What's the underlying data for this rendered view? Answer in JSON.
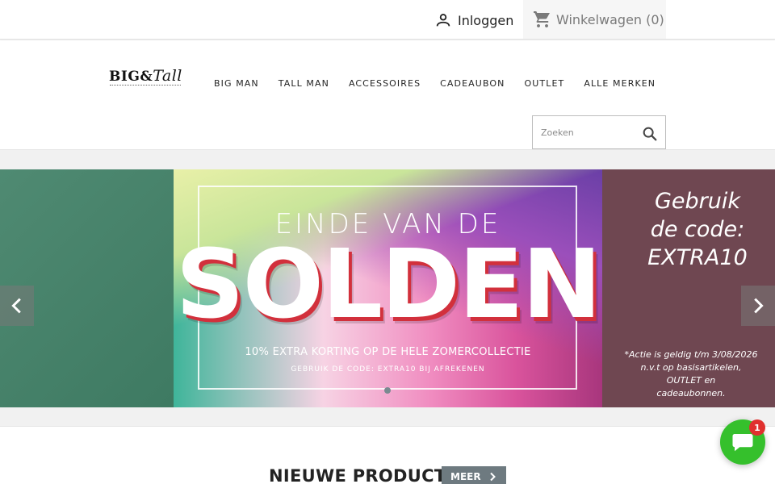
{
  "topbar": {
    "login_label": "Inloggen",
    "cart_label": "Winkelwagen",
    "cart_count": "(0)"
  },
  "header": {
    "logo_big": "BIG",
    "logo_amp": "&",
    "logo_tall": "Tall",
    "nav": [
      "BIG MAN",
      "TALL MAN",
      "ACCESSOIRES",
      "CADEAUBON",
      "OUTLET",
      "ALLE MERKEN"
    ],
    "search_placeholder": "Zoeken"
  },
  "slider": {
    "headline_top": "EINDE VAN DE",
    "headline_main": "SOLDEN",
    "subline": "10% EXTRA KORTING OP DE HELE ZOMERCOLLECTIE",
    "code_hint": "GEBRUIK DE CODE: EXTRA10 BIJ AFREKENEN",
    "code_text_1": "Gebruik",
    "code_text_2": "de code:",
    "code_text_3": "EXTRA10",
    "disclaimer_1": "*Actie is geldig t/m 3/08/2026",
    "disclaimer_2": "n.v.t op  basisartikelen,",
    "disclaimer_3": "OUTLET en",
    "disclaimer_4": "cadeaubonnen.",
    "active_slide": 1,
    "slide_count": 1
  },
  "section": {
    "title": "NIEUWE PRODUCTEN",
    "more_label": "MEER"
  },
  "chat": {
    "badge_count": "1"
  },
  "colors": {
    "accent_chat": "#35c02c",
    "badge": "#e0302e",
    "more_button": "#6e7a80"
  }
}
